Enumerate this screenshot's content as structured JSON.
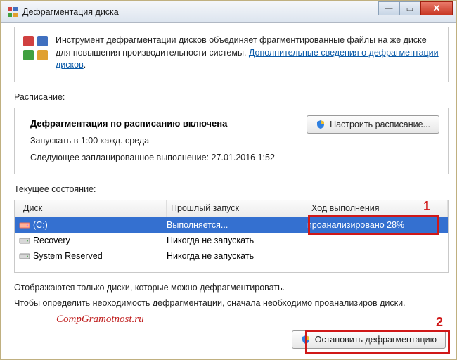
{
  "window": {
    "title": "Дефрагментация диска"
  },
  "panel": {
    "text_prefix": "Инструмент дефрагментации дисков объединяет фрагментированные файлы на же диске для повышения производительности системы. ",
    "link_text": "Дополнительные сведения о дефрагментации дисков",
    "period": "."
  },
  "schedule": {
    "label": "Расписание:",
    "title": "Дефрагментация по расписанию включена",
    "run_line": "Запускать в 1:00 кажд. среда",
    "next_line": "Следующее запланированное выполнение: 27.01.2016 1:52",
    "config_btn": "Настроить расписание..."
  },
  "status": {
    "label": "Текущее состояние:",
    "columns": {
      "c1": "Диск",
      "c2": "Прошлый запуск",
      "c3": "Ход выполнения"
    },
    "rows": [
      {
        "name": "(C:)",
        "last": "Выполняется...",
        "progress": "проанализировано 28%",
        "selected": true
      },
      {
        "name": "Recovery",
        "last": "Никогда не запускать",
        "progress": "",
        "selected": false
      },
      {
        "name": "System Reserved",
        "last": "Никогда не запускать",
        "progress": "",
        "selected": false
      }
    ]
  },
  "footer": {
    "note1": "Отображаются только диски, которые можно дефрагментировать.",
    "note2": "Чтобы определить неоходимость  дефрагментации, сначала необходимо проанализиров диски.",
    "watermark": "CompGramotnost.ru",
    "stop_btn": "Остановить дефрагментацию"
  },
  "annotations": {
    "num1": "1",
    "num2": "2"
  }
}
